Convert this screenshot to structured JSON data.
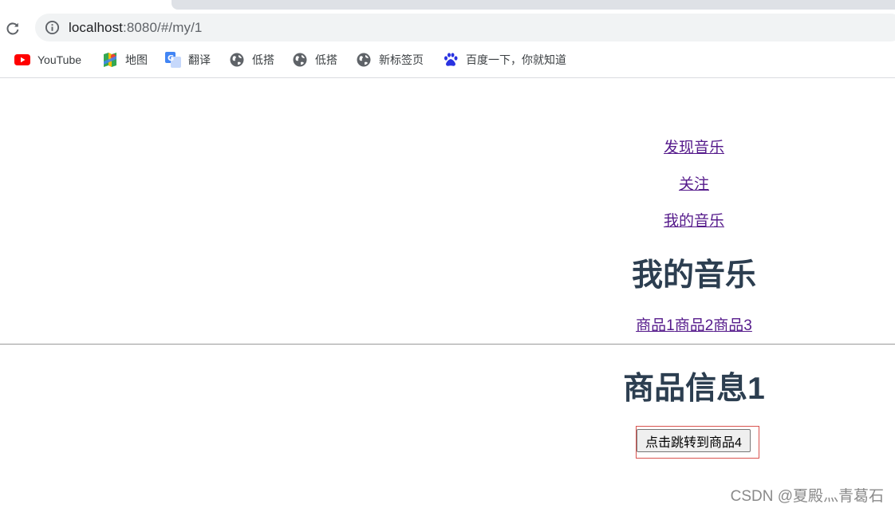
{
  "browser": {
    "url_host": "localhost",
    "url_rest": ":8080/#/my/1",
    "bookmarks": [
      {
        "label": "YouTube",
        "icon": "youtube-icon"
      },
      {
        "label": "地图",
        "icon": "maps-icon"
      },
      {
        "label": "翻译",
        "icon": "translate-icon"
      },
      {
        "label": "低搭",
        "icon": "globe-icon"
      },
      {
        "label": "低搭",
        "icon": "globe-icon"
      },
      {
        "label": "新标签页",
        "icon": "globe-icon"
      },
      {
        "label": "百度一下，你就知道",
        "icon": "baidu-icon"
      }
    ]
  },
  "nav": {
    "discover": "发现音乐",
    "follow": "关注",
    "my_music": "我的音乐"
  },
  "main": {
    "title": "我的音乐",
    "items": [
      "商品1",
      "商品2",
      "商品3"
    ],
    "detail_title": "商品信息1",
    "jump_button": "点击跳转到商品4"
  },
  "watermark": "CSDN @夏殿灬青葛石",
  "colors": {
    "link_visited": "#551a8b",
    "heading": "#2c3e50",
    "highlight_border": "#d9534f"
  }
}
